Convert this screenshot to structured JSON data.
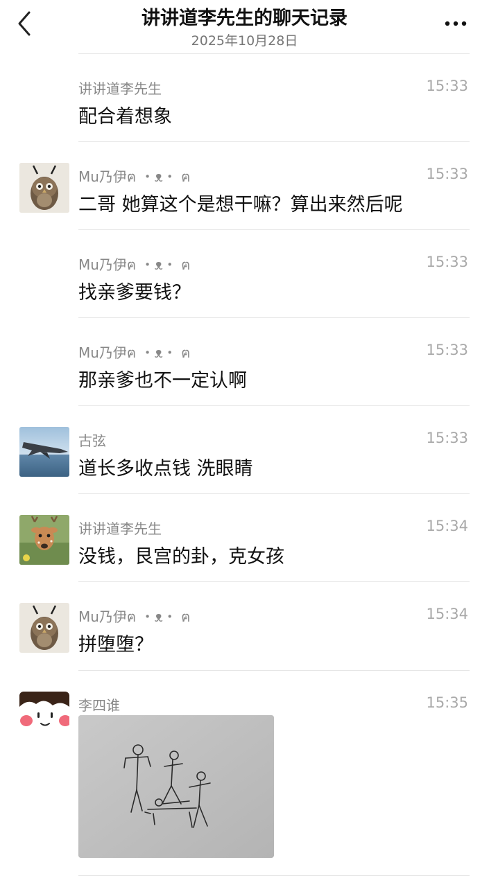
{
  "header": {
    "title": "讲讲道李先生的聊天记录",
    "date": "2025年10月28日"
  },
  "messages": [
    {
      "sender": "讲讲道李先生",
      "time": "15:33",
      "text": "配合着想象",
      "avatar": "none"
    },
    {
      "sender": "Mu乃伊ฅ ・ᴥ・ ฅ",
      "time": "15:33",
      "text": "二哥 她算这个是想干嘛？算出来然后呢",
      "avatar": "owl-avatar"
    },
    {
      "sender": "Mu乃伊ฅ ・ᴥ・ ฅ",
      "time": "15:33",
      "text": "找亲爹要钱？",
      "avatar": "none"
    },
    {
      "sender": "Mu乃伊ฅ ・ᴥ・ ฅ",
      "time": "15:33",
      "text": "那亲爹也不一定认啊",
      "avatar": "none"
    },
    {
      "sender": "古弦",
      "time": "15:33",
      "text": "道长多收点钱  洗眼睛",
      "avatar": "jet-avatar"
    },
    {
      "sender": "讲讲道李先生",
      "time": "15:34",
      "text": "没钱，艮宫的卦，克女孩",
      "avatar": "deer-avatar"
    },
    {
      "sender": "Mu乃伊ฅ ・ᴥ・ ฅ",
      "time": "15:34",
      "text": "拼堕堕？",
      "avatar": "owl-avatar"
    },
    {
      "sender": "李四谁",
      "time": "15:35",
      "text": "",
      "avatar": "cartoon-girl-avatar",
      "image": "stick-figure-sketch"
    }
  ],
  "icons": {
    "back": "chevron-left-icon",
    "more": "more-dots-icon"
  }
}
